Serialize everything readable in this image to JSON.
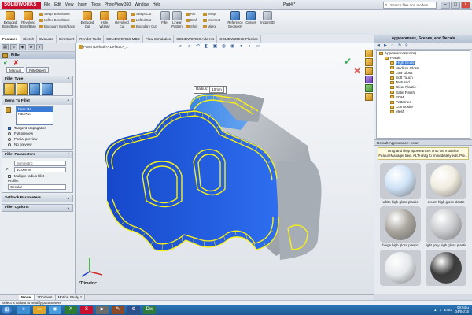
{
  "app": {
    "logo": "SOLIDWORKS",
    "document_title": "Part4 *"
  },
  "menu": [
    "File",
    "Edit",
    "View",
    "Insert",
    "Tools",
    "PhotoView 360",
    "Window",
    "Help"
  ],
  "search": {
    "placeholder": "Search files and models"
  },
  "ribbon": {
    "extruded_boss": "Extruded Boss/Base",
    "revolved_boss": "Revolved Boss/Base",
    "swept_boss": "Swept Boss/Base",
    "lofted_boss": "Lofted Boss/Base",
    "boundary_boss": "Boundary Boss/Base",
    "extruded_cut": "Extruded Cut",
    "hole_wizard": "Hole Wizard",
    "revolved_cut": "Revolved Cut",
    "swept_cut": "Swept Cut",
    "lofted_cut": "Lofted Cut",
    "boundary_cut": "Boundary Cut",
    "fillet": "Fillet",
    "linear_pattern": "Linear Pattern",
    "rib": "Rib",
    "draft": "Draft",
    "shell": "Shell",
    "wrap": "Wrap",
    "intersect": "Intersect",
    "mirror": "Mirror",
    "reference_geometry": "Reference Geometry",
    "curves": "Curves",
    "instant3d": "Instant3D"
  },
  "command_tabs": [
    "Features",
    "Sketch",
    "Evaluate",
    "DimXpert",
    "Render Tools",
    "SOLIDWORKS MBD",
    "Flow Simulation",
    "SOLIDWORKS Add-Ins",
    "SOLIDWORKS Plastics"
  ],
  "property_manager": {
    "title": "Fillet",
    "subtabs": [
      "Manual",
      "FilletXpert"
    ],
    "fillet_type_heading": "Fillet Type",
    "items_heading": "Items To Fillet",
    "items": [
      "Face<1>",
      "Face<2>"
    ],
    "tangent_propagation": "Tangent propagation",
    "full_preview": "Full preview",
    "partial_preview": "Partial preview",
    "no_preview": "No preview",
    "fillet_params_heading": "Fillet Parameters",
    "symmetric": "Symmetric",
    "radius_value": "10.00mm",
    "multiple_radius": "Multiple radius fillet",
    "profile_label": "Profile:",
    "profile_value": "Circular",
    "setback_heading": "Setback Parameters",
    "fillet_options_heading": "Fillet Options"
  },
  "graphics": {
    "breadcrumb": "Part4 (Default<<Default>_...",
    "radius_label": "Radius:",
    "radius_value": "10mm",
    "view_name": "*Trimetric"
  },
  "appearances": {
    "title": "Appearances, Scenes, and Decals",
    "tree": [
      {
        "label": "Appearances(color)",
        "level": 0,
        "selected": false
      },
      {
        "label": "Plastic",
        "level": 1,
        "selected": false
      },
      {
        "label": "High Gloss",
        "level": 2,
        "selected": true
      },
      {
        "label": "Medium Gloss",
        "level": 2,
        "selected": false
      },
      {
        "label": "Low Gloss",
        "level": 2,
        "selected": false
      },
      {
        "label": "Soft Touch",
        "level": 2,
        "selected": false
      },
      {
        "label": "Textured",
        "level": 2,
        "selected": false
      },
      {
        "label": "Clear Plastic",
        "level": 2,
        "selected": false
      },
      {
        "label": "Satin Finish",
        "level": 2,
        "selected": false
      },
      {
        "label": "EDM",
        "level": 2,
        "selected": false
      },
      {
        "label": "Patterned",
        "level": 2,
        "selected": false
      },
      {
        "label": "Composite",
        "level": 2,
        "selected": false
      },
      {
        "label": "Mesh",
        "level": 2,
        "selected": false
      }
    ],
    "default_heading": "Default Appearance: color",
    "drag_tip": "Drag and drop appearances onto the model or FeatureManager tree. ALT+drag to immediately edit. Pre...",
    "swatches": [
      {
        "label": "white high gloss plastic",
        "color": "#cfe3f7"
      },
      {
        "label": "cream high gloss plastic",
        "color": "#f1ece0"
      },
      {
        "label": "beige high gloss plastic",
        "color": "#a9a59e"
      },
      {
        "label": "light grey high gloss plastic",
        "color": "#c9cbce"
      },
      {
        "label": "",
        "color": "#e5e8ec"
      },
      {
        "label": "",
        "color": "#3a3a3a"
      }
    ]
  },
  "bottom_tabs": [
    "Model",
    "3D Views",
    "Motion Study 1"
  ],
  "status_bar": "Select a callout to modify parameters",
  "tray": {
    "lang": "ENG",
    "time": "09:54 µ",
    "date": "04/04/15"
  }
}
